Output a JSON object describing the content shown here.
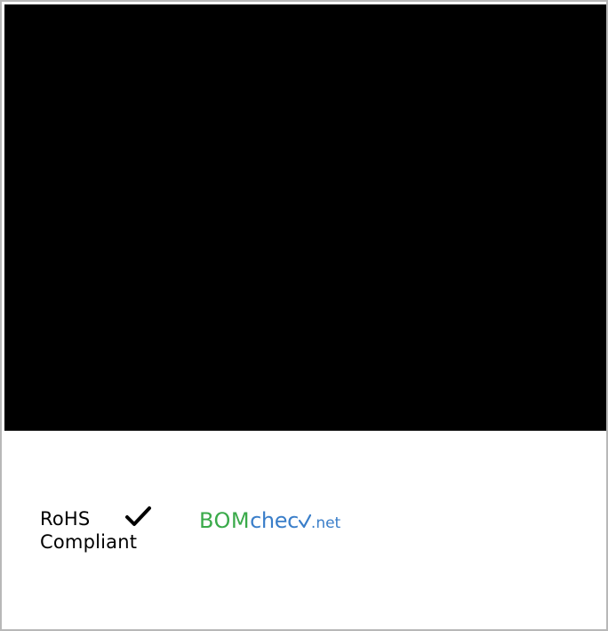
{
  "logos": {
    "rohs": {
      "line1": "RoHS",
      "line2": "Compliant",
      "mark": "check-icon"
    },
    "bomcheck": {
      "part1": "BOM",
      "part2": "chec",
      "part3": ".net",
      "colors": {
        "bom": "#3aaa4a",
        "check": "#3a7ec9"
      }
    }
  },
  "panel": {
    "color": "#000000"
  }
}
